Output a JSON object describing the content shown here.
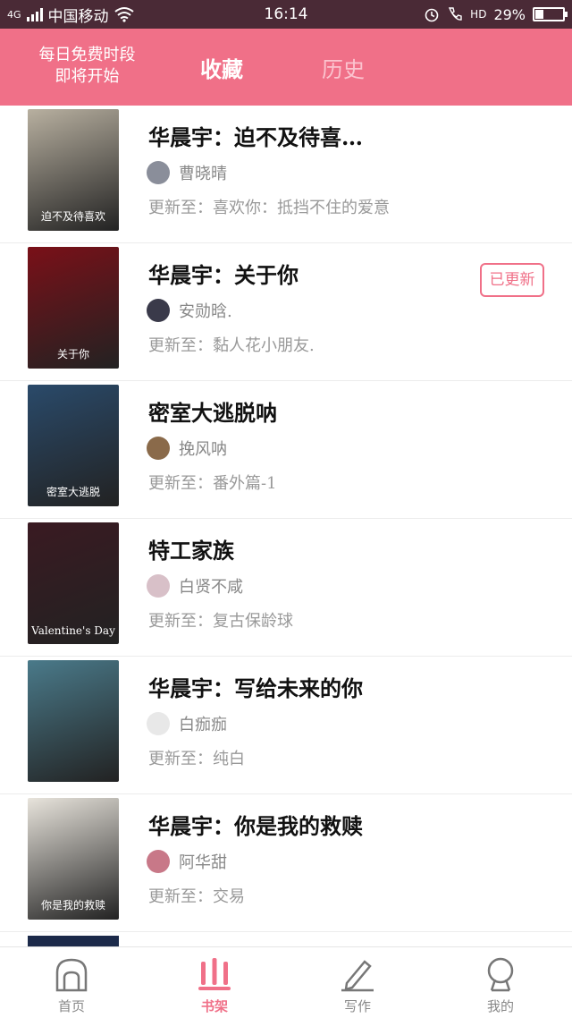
{
  "status_bar": {
    "network": "4G",
    "carrier": "中国移动",
    "time": "16:14",
    "hd": "HD",
    "battery": "29%",
    "battery_level": 0.29
  },
  "header": {
    "promo_line1": "每日免费时段",
    "promo_line2": "即将开始",
    "tab_favorites": "收藏",
    "tab_history": "历史"
  },
  "books": [
    {
      "title": "华晨宇：迫不及待喜…",
      "author": "曹晓晴",
      "update": "更新至：喜欢你：抵挡不住的爱意",
      "badge": "",
      "cover_text": "迫不及待喜欢",
      "cover_color": "#b8b0a0",
      "avatar_color": "#8a8e9a"
    },
    {
      "title": "华晨宇：关于你",
      "author": "安勋晗.",
      "update": "更新至：黏人花小朋友.",
      "badge": "已更新",
      "cover_text": "关于你",
      "cover_color": "#7a1018",
      "avatar_color": "#3a3a4a"
    },
    {
      "title": "密室大逃脱呐",
      "author": "挽风呐",
      "update": "更新至：番外篇-1",
      "badge": "",
      "cover_text": "密室大逃脱",
      "cover_color": "#2a4a6a",
      "avatar_color": "#8a6a4a"
    },
    {
      "title": "特工家族",
      "author": "白贤不咸",
      "update": "更新至：复古保龄球",
      "badge": "",
      "cover_text": "Valentine's Day",
      "cover_color": "#3a1a22",
      "avatar_color": "#d8c0c8"
    },
    {
      "title": "华晨宇：写给未来的你",
      "author": "白痂痂",
      "update": "更新至：纯白",
      "badge": "",
      "cover_text": "",
      "cover_color": "#4a7a8a",
      "avatar_color": "#e8e8e8"
    },
    {
      "title": "华晨宇：你是我的救赎",
      "author": "阿华甜",
      "update": "更新至：交易",
      "badge": "",
      "cover_text": "你是我的救赎",
      "cover_color": "#e8e4dc",
      "avatar_color": "#c87888"
    }
  ],
  "nav": {
    "home": "首页",
    "shelf": "书架",
    "write": "写作",
    "mine": "我的"
  },
  "colors": {
    "accent": "#f07088",
    "status_bar": "#4a2a36"
  }
}
